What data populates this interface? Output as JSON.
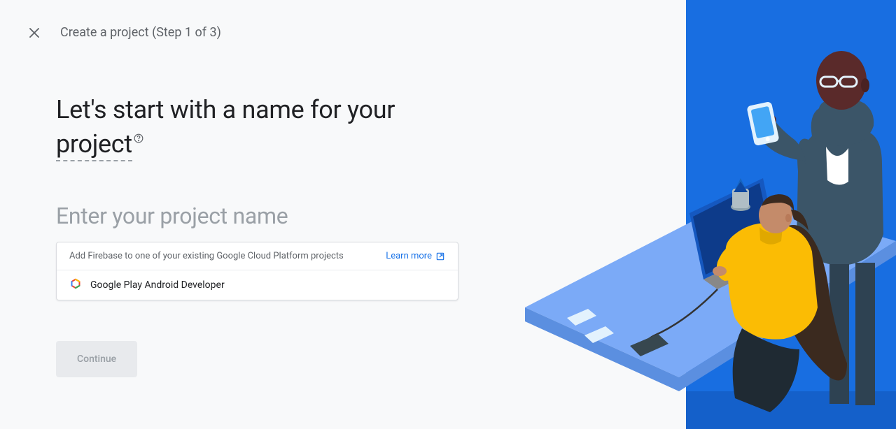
{
  "header": {
    "title": "Create a project (Step 1 of 3)"
  },
  "heading": {
    "prefix": "Let's start with a name for your ",
    "underlined": "project"
  },
  "input": {
    "placeholder": "Enter your project name"
  },
  "dropdown": {
    "header_text": "Add Firebase to one of your existing Google Cloud Platform projects",
    "learn_more": "Learn more",
    "items": [
      {
        "label": "Google Play Android Developer"
      }
    ]
  },
  "actions": {
    "continue": "Continue"
  }
}
